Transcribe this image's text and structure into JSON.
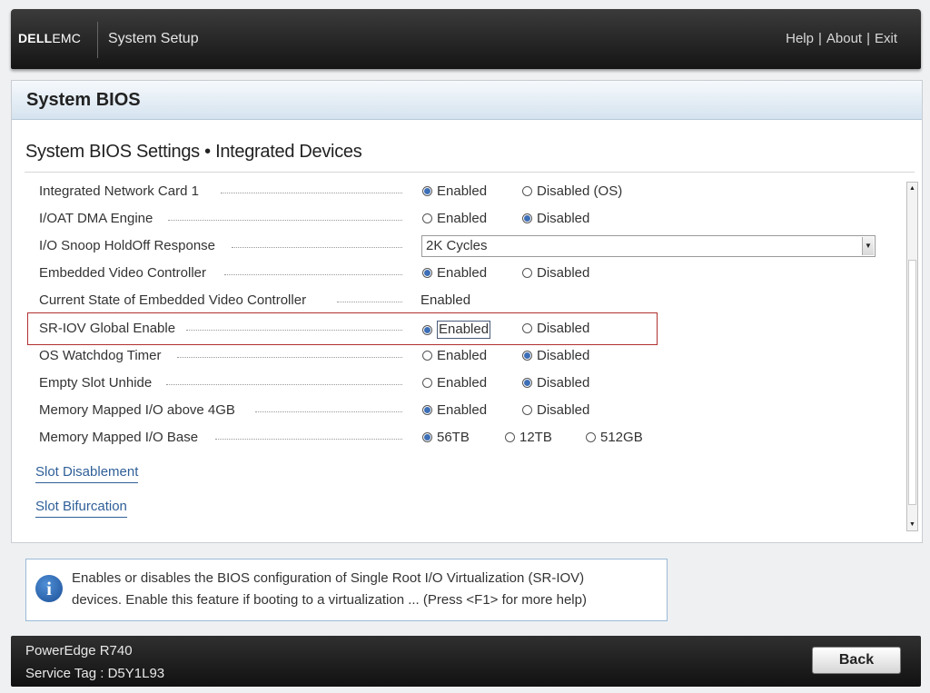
{
  "header": {
    "logo_text": "DELL",
    "logo_suffix": "EMC",
    "app_title": "System Setup",
    "links": {
      "help": "Help",
      "about": "About",
      "exit": "Exit",
      "separator": "|"
    }
  },
  "panel": {
    "title": "System BIOS",
    "section_title": "System BIOS Settings • Integrated Devices"
  },
  "settings": {
    "integrated_network_card": {
      "label": "Integrated Network Card 1",
      "options": [
        "Enabled",
        "Disabled (OS)"
      ],
      "selected": "Enabled"
    },
    "ioat_dma": {
      "label": "I/OAT DMA Engine",
      "options": [
        "Enabled",
        "Disabled"
      ],
      "selected": "Disabled"
    },
    "io_snoop": {
      "label": "I/O Snoop HoldOff Response",
      "value": "2K Cycles"
    },
    "embedded_video": {
      "label": "Embedded Video Controller",
      "options": [
        "Enabled",
        "Disabled"
      ],
      "selected": "Enabled"
    },
    "current_video_state": {
      "label": "Current State of Embedded Video Controller",
      "value": "Enabled"
    },
    "sriov": {
      "label": "SR-IOV Global Enable",
      "options": [
        "Enabled",
        "Disabled"
      ],
      "selected": "Enabled"
    },
    "os_watchdog": {
      "label": "OS Watchdog Timer",
      "options": [
        "Enabled",
        "Disabled"
      ],
      "selected": "Disabled"
    },
    "empty_slot": {
      "label": "Empty Slot Unhide",
      "options": [
        "Enabled",
        "Disabled"
      ],
      "selected": "Disabled"
    },
    "mmio_above_4gb": {
      "label": "Memory Mapped I/O above 4GB",
      "options": [
        "Enabled",
        "Disabled"
      ],
      "selected": "Enabled"
    },
    "mmio_base": {
      "label": "Memory Mapped I/O Base",
      "options": [
        "56TB",
        "12TB",
        "512GB"
      ],
      "selected": "56TB"
    }
  },
  "links": {
    "slot_disablement": "Slot Disablement",
    "slot_bifurcation": "Slot Bifurcation"
  },
  "info": {
    "icon_glyph": "i",
    "line1": "Enables or disables the BIOS configuration of Single Root I/O Virtualization (SR-IOV)",
    "line2": "devices. Enable this feature if booting to a virtualization ... (Press <F1> for more help)"
  },
  "footer": {
    "model": "PowerEdge R740",
    "service_tag": "Service Tag : D5Y1L93",
    "back_label": "Back"
  },
  "colors": {
    "accent": "#3d6fb7",
    "highlight_border": "#b03030",
    "link": "#2f5f98"
  }
}
